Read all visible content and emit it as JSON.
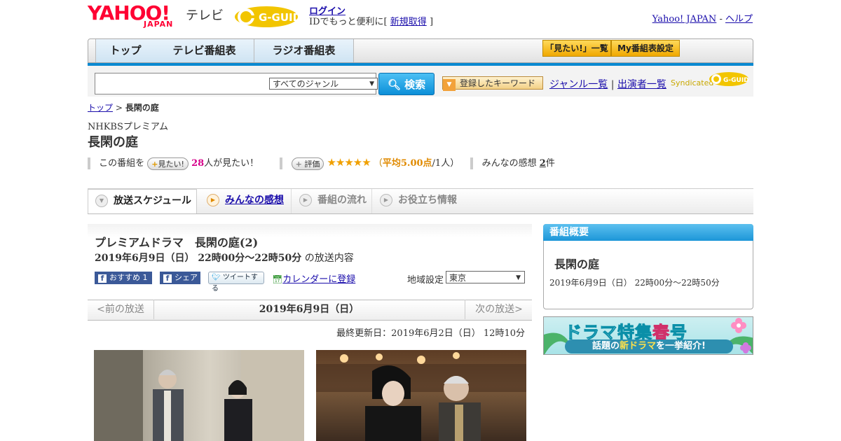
{
  "header": {
    "logo_text": "YAHOO!",
    "logo_sub": "JAPAN",
    "service_name": "テレビ",
    "gguide_logo": "G-GUIDE",
    "login_label": "ログイン",
    "login_prompt_prefix": "IDでもっと便利に[",
    "signup_label": "新規取得",
    "login_prompt_suffix": "]",
    "yahoo_japan_link": "Yahoo! JAPAN",
    "separator": "-",
    "help_link": "ヘルプ"
  },
  "nav": {
    "tabs": [
      "トップ",
      "テレビ番組表",
      "ラジオ番組表"
    ],
    "want_list_button": "「見たい!」一覧",
    "my_schedule_button": "My番組表設定"
  },
  "search": {
    "input_value": "",
    "genre_selected": "すべてのジャンル",
    "search_button": "検索",
    "keyword_button": "登録したキーワード",
    "genre_list_link": "ジャンル一覧",
    "link_separator": "|",
    "performer_list_link": "出演者一覧",
    "syndicated_text": "Syndicated",
    "syndicated_logo": "G-GUIDE"
  },
  "breadcrumb": {
    "top_link": "トップ",
    "separator": ">",
    "current": "長閑の庭"
  },
  "program": {
    "channel": "NHKBSプレミアム",
    "title": "長閑の庭",
    "want_prefix": "この番組を",
    "want_button": "見たい!",
    "want_count": "28",
    "want_suffix": "人が見たい！",
    "rate_button": "評価",
    "stars": "★★★★★",
    "rating_open": "（",
    "rating_avg_label": "平均5.00点",
    "rating_count": "/1人）",
    "impressions_label": "みんなの感想",
    "impressions_count": "2",
    "impressions_unit": "件"
  },
  "tabs": {
    "schedule": "放送スケジュール",
    "impressions": "みんなの感想",
    "flow": "番組の流れ",
    "info": "お役立ち情報"
  },
  "episode": {
    "title": "プレミアムドラマ　長閑の庭(2)",
    "datetime": "2019年6月9日（日）  22時00分～22時50分",
    "datetime_suffix": "の放送内容",
    "fb_recommend": "おすすめ 1",
    "fb_share": "シェア",
    "tweet": "ツイートする",
    "calendar": "カレンダーに登録",
    "region_label": "地域設定",
    "region_selected": "東京"
  },
  "date_nav": {
    "prev": "<前の放送",
    "current": "2019年6月9日（日）",
    "next": "次の放送>"
  },
  "updated": "最終更新日：2019年6月2日（日）  12時10分",
  "sidebar": {
    "header": "番組概要",
    "title": "長閑の庭",
    "datetime": "2019年6月9日（日）  22時00分～22時50分"
  },
  "banner": {
    "main_pre": "ドラマ特集",
    "main_haru": "春",
    "main_post": "号",
    "sub_pre": "話題の",
    "sub_hl": "新ドラマ",
    "sub_post": "を一挙紹介!"
  },
  "colors": {
    "accent_blue": "#0a89d1",
    "yahoo_red": "#ff0033",
    "star_orange": "#f0a000",
    "want_pink": "#d6008a"
  }
}
